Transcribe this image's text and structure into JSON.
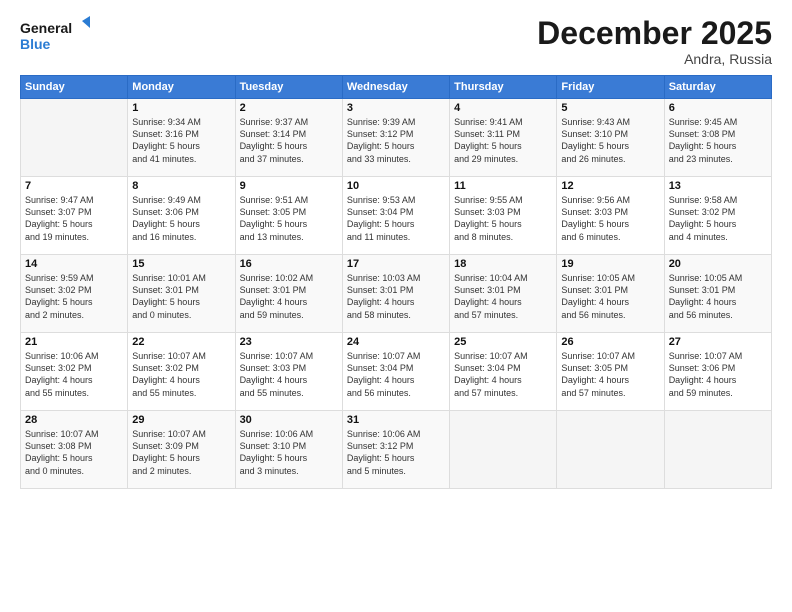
{
  "logo": {
    "line1": "General",
    "line2": "Blue"
  },
  "title": "December 2025",
  "subtitle": "Andra, Russia",
  "header_days": [
    "Sunday",
    "Monday",
    "Tuesday",
    "Wednesday",
    "Thursday",
    "Friday",
    "Saturday"
  ],
  "weeks": [
    [
      {
        "day": "",
        "content": ""
      },
      {
        "day": "1",
        "content": "Sunrise: 9:34 AM\nSunset: 3:16 PM\nDaylight: 5 hours\nand 41 minutes."
      },
      {
        "day": "2",
        "content": "Sunrise: 9:37 AM\nSunset: 3:14 PM\nDaylight: 5 hours\nand 37 minutes."
      },
      {
        "day": "3",
        "content": "Sunrise: 9:39 AM\nSunset: 3:12 PM\nDaylight: 5 hours\nand 33 minutes."
      },
      {
        "day": "4",
        "content": "Sunrise: 9:41 AM\nSunset: 3:11 PM\nDaylight: 5 hours\nand 29 minutes."
      },
      {
        "day": "5",
        "content": "Sunrise: 9:43 AM\nSunset: 3:10 PM\nDaylight: 5 hours\nand 26 minutes."
      },
      {
        "day": "6",
        "content": "Sunrise: 9:45 AM\nSunset: 3:08 PM\nDaylight: 5 hours\nand 23 minutes."
      }
    ],
    [
      {
        "day": "7",
        "content": "Sunrise: 9:47 AM\nSunset: 3:07 PM\nDaylight: 5 hours\nand 19 minutes."
      },
      {
        "day": "8",
        "content": "Sunrise: 9:49 AM\nSunset: 3:06 PM\nDaylight: 5 hours\nand 16 minutes."
      },
      {
        "day": "9",
        "content": "Sunrise: 9:51 AM\nSunset: 3:05 PM\nDaylight: 5 hours\nand 13 minutes."
      },
      {
        "day": "10",
        "content": "Sunrise: 9:53 AM\nSunset: 3:04 PM\nDaylight: 5 hours\nand 11 minutes."
      },
      {
        "day": "11",
        "content": "Sunrise: 9:55 AM\nSunset: 3:03 PM\nDaylight: 5 hours\nand 8 minutes."
      },
      {
        "day": "12",
        "content": "Sunrise: 9:56 AM\nSunset: 3:03 PM\nDaylight: 5 hours\nand 6 minutes."
      },
      {
        "day": "13",
        "content": "Sunrise: 9:58 AM\nSunset: 3:02 PM\nDaylight: 5 hours\nand 4 minutes."
      }
    ],
    [
      {
        "day": "14",
        "content": "Sunrise: 9:59 AM\nSunset: 3:02 PM\nDaylight: 5 hours\nand 2 minutes."
      },
      {
        "day": "15",
        "content": "Sunrise: 10:01 AM\nSunset: 3:01 PM\nDaylight: 5 hours\nand 0 minutes."
      },
      {
        "day": "16",
        "content": "Sunrise: 10:02 AM\nSunset: 3:01 PM\nDaylight: 4 hours\nand 59 minutes."
      },
      {
        "day": "17",
        "content": "Sunrise: 10:03 AM\nSunset: 3:01 PM\nDaylight: 4 hours\nand 58 minutes."
      },
      {
        "day": "18",
        "content": "Sunrise: 10:04 AM\nSunset: 3:01 PM\nDaylight: 4 hours\nand 57 minutes."
      },
      {
        "day": "19",
        "content": "Sunrise: 10:05 AM\nSunset: 3:01 PM\nDaylight: 4 hours\nand 56 minutes."
      },
      {
        "day": "20",
        "content": "Sunrise: 10:05 AM\nSunset: 3:01 PM\nDaylight: 4 hours\nand 56 minutes."
      }
    ],
    [
      {
        "day": "21",
        "content": "Sunrise: 10:06 AM\nSunset: 3:02 PM\nDaylight: 4 hours\nand 55 minutes."
      },
      {
        "day": "22",
        "content": "Sunrise: 10:07 AM\nSunset: 3:02 PM\nDaylight: 4 hours\nand 55 minutes."
      },
      {
        "day": "23",
        "content": "Sunrise: 10:07 AM\nSunset: 3:03 PM\nDaylight: 4 hours\nand 55 minutes."
      },
      {
        "day": "24",
        "content": "Sunrise: 10:07 AM\nSunset: 3:04 PM\nDaylight: 4 hours\nand 56 minutes."
      },
      {
        "day": "25",
        "content": "Sunrise: 10:07 AM\nSunset: 3:04 PM\nDaylight: 4 hours\nand 57 minutes."
      },
      {
        "day": "26",
        "content": "Sunrise: 10:07 AM\nSunset: 3:05 PM\nDaylight: 4 hours\nand 57 minutes."
      },
      {
        "day": "27",
        "content": "Sunrise: 10:07 AM\nSunset: 3:06 PM\nDaylight: 4 hours\nand 59 minutes."
      }
    ],
    [
      {
        "day": "28",
        "content": "Sunrise: 10:07 AM\nSunset: 3:08 PM\nDaylight: 5 hours\nand 0 minutes."
      },
      {
        "day": "29",
        "content": "Sunrise: 10:07 AM\nSunset: 3:09 PM\nDaylight: 5 hours\nand 2 minutes."
      },
      {
        "day": "30",
        "content": "Sunrise: 10:06 AM\nSunset: 3:10 PM\nDaylight: 5 hours\nand 3 minutes."
      },
      {
        "day": "31",
        "content": "Sunrise: 10:06 AM\nSunset: 3:12 PM\nDaylight: 5 hours\nand 5 minutes."
      },
      {
        "day": "",
        "content": ""
      },
      {
        "day": "",
        "content": ""
      },
      {
        "day": "",
        "content": ""
      }
    ]
  ]
}
